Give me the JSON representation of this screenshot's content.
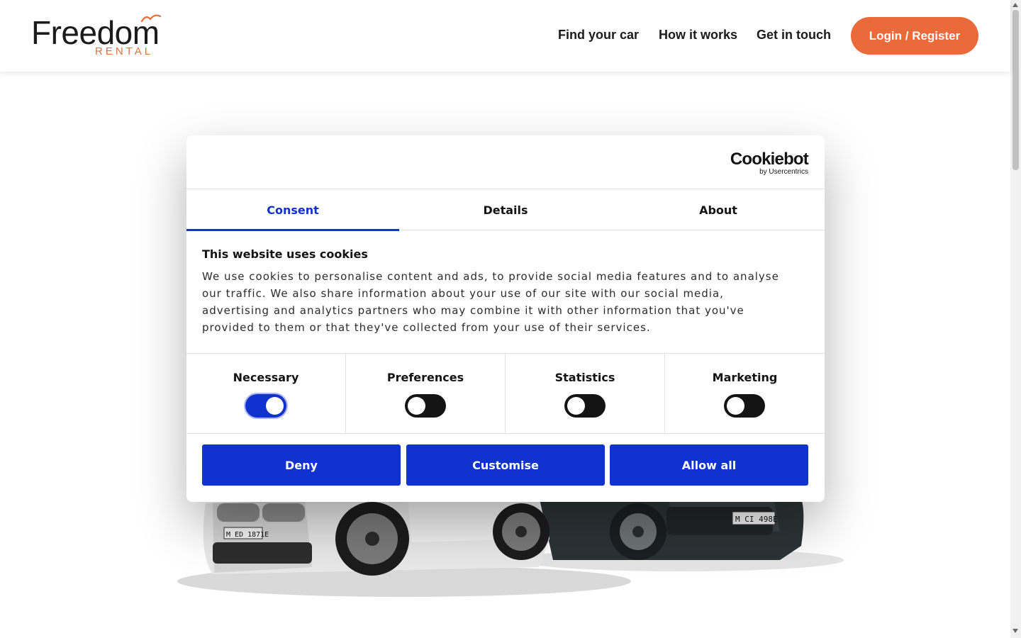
{
  "brand": {
    "name": "Freedom",
    "sub": "RENTAL",
    "accent": "#ec6a3a"
  },
  "nav": {
    "items": [
      {
        "label": "Find your car"
      },
      {
        "label": "How it works"
      },
      {
        "label": "Get in touch"
      }
    ],
    "login_label": "Login / Register"
  },
  "hero": {
    "plate_left": "M ED 1871E",
    "plate_right": "M CI 498E"
  },
  "cookie": {
    "provider": "Cookiebot",
    "provider_sub": "by Usercentrics",
    "tabs": [
      {
        "label": "Consent",
        "active": true
      },
      {
        "label": "Details",
        "active": false
      },
      {
        "label": "About",
        "active": false
      }
    ],
    "title": "This website uses cookies",
    "text": "We use cookies to personalise content and ads, to provide social media features and to analyse our traffic. We also share information about your use of our site with our social media, advertising and analytics partners who may combine it with other information that you've provided to them or that they've collected from your use of their services.",
    "categories": [
      {
        "label": "Necessary",
        "enabled": true
      },
      {
        "label": "Preferences",
        "enabled": false
      },
      {
        "label": "Statistics",
        "enabled": false
      },
      {
        "label": "Marketing",
        "enabled": false
      }
    ],
    "buttons": {
      "deny": "Deny",
      "customise": "Customise",
      "allow_all": "Allow all"
    },
    "accent": "#1032cf"
  }
}
